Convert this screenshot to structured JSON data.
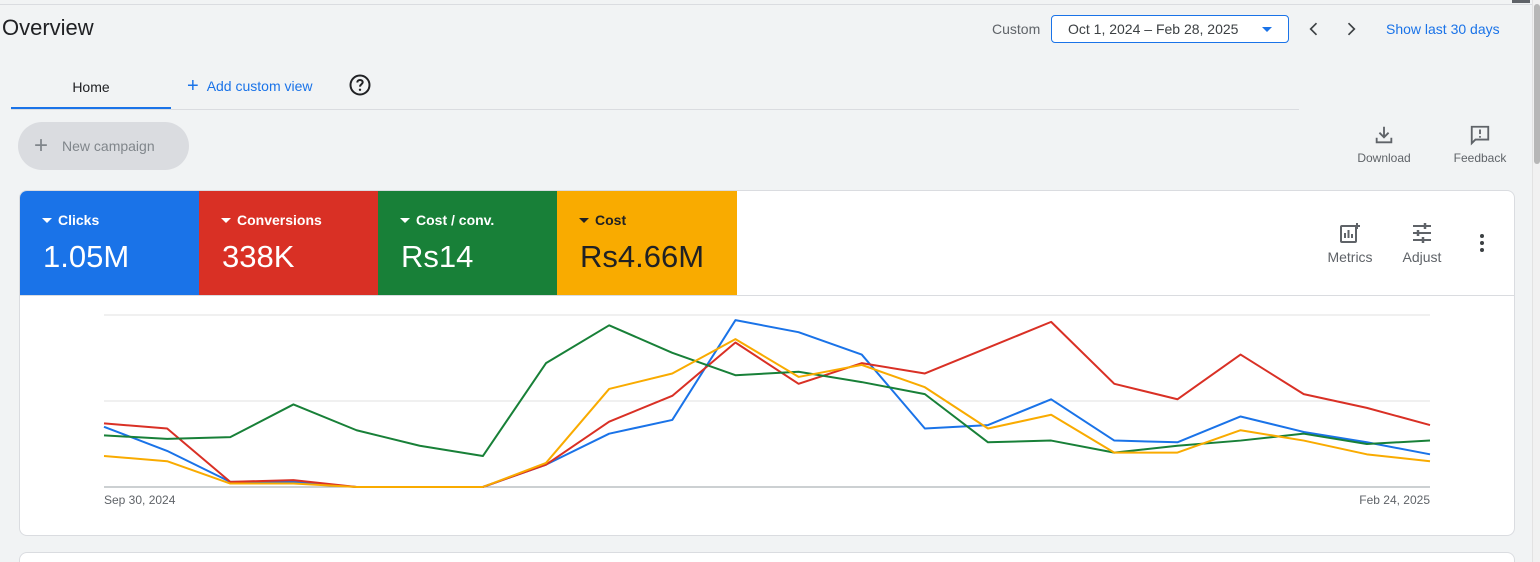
{
  "header": {
    "title": "Overview",
    "date_label": "Custom",
    "date_range": "Oct 1, 2024 – Feb 28, 2025",
    "show_last": "Show last 30 days"
  },
  "tabs": {
    "home": "Home",
    "add_custom": "Add custom view"
  },
  "toolbar": {
    "new_campaign": "New campaign",
    "download": "Download",
    "feedback": "Feedback"
  },
  "metrics": [
    {
      "label": "Clicks",
      "value": "1.05M",
      "color": "#1a73e8"
    },
    {
      "label": "Conversions",
      "value": "338K",
      "color": "#d93025"
    },
    {
      "label": "Cost / conv.",
      "value": "Rs14",
      "color": "#188038"
    },
    {
      "label": "Cost",
      "value": "Rs4.66M",
      "color": "#f9ab00"
    }
  ],
  "card_tools": {
    "metrics": "Metrics",
    "adjust": "Adjust"
  },
  "chart_data": {
    "type": "line",
    "x_start_label": "Sep 30, 2024",
    "x_end_label": "Feb 24, 2025",
    "points_per_series": 22,
    "ylim": [
      0,
      100
    ],
    "grid": true,
    "series": [
      {
        "color": "#1a73e8",
        "values": [
          35,
          21,
          3,
          3,
          0,
          0,
          0,
          13,
          31,
          39,
          97,
          90,
          77,
          34,
          36,
          51,
          27,
          26,
          41,
          32,
          26,
          19
        ]
      },
      {
        "color": "#d93025",
        "values": [
          37,
          34,
          3,
          4,
          0,
          0,
          0,
          13,
          38,
          53,
          84,
          60,
          72,
          66,
          81,
          96,
          60,
          51,
          77,
          54,
          46,
          36
        ]
      },
      {
        "color": "#188038",
        "values": [
          30,
          28,
          29,
          48,
          33,
          24,
          18,
          72,
          94,
          78,
          65,
          67,
          61,
          54,
          26,
          27,
          20,
          24,
          27,
          31,
          25,
          27
        ]
      },
      {
        "color": "#f9ab00",
        "values": [
          18,
          15,
          2,
          2,
          0,
          0,
          0,
          14,
          57,
          66,
          86,
          64,
          71,
          58,
          34,
          42,
          20,
          20,
          33,
          27,
          19,
          15
        ]
      }
    ]
  }
}
